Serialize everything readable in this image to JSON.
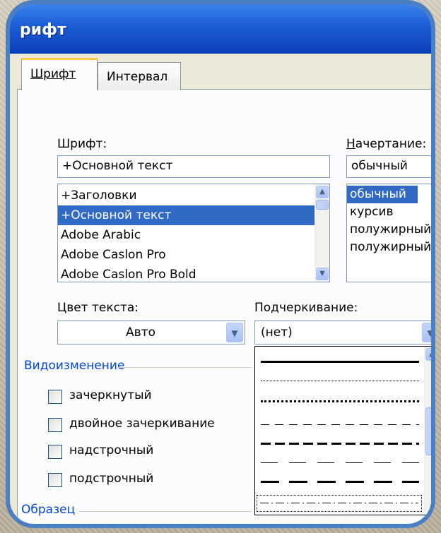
{
  "window": {
    "title": "рифт"
  },
  "tabs": [
    {
      "label": "Шрифт",
      "active": true
    },
    {
      "label": "Интервал",
      "active": false
    }
  ],
  "font": {
    "label": "Шрифт:",
    "value": "+Основной текст",
    "items": [
      "+Заголовки",
      "+Основной текст",
      "Adobe Arabic",
      "Adobe Caslon Pro",
      "Adobe Caslon Pro Bold"
    ],
    "selected_index": 1
  },
  "style": {
    "label": "Начертание:",
    "value": "обычный",
    "items": [
      "обычный",
      "курсив",
      "полужирный",
      "полужирный"
    ],
    "selected_index": 0
  },
  "color": {
    "label": "Цвет текста:",
    "value": "Авто"
  },
  "underline": {
    "label": "Подчеркивание:",
    "value": "(нет)",
    "options": [
      "solid",
      "dotted-fine",
      "dotted-heavy",
      "dashed",
      "dashed-heavy",
      "long-dash",
      "long-dash-heavy",
      "dash-dot"
    ],
    "selected_option": "dash-dot"
  },
  "effects": {
    "label": "Видоизменение",
    "items": [
      "зачеркнутый",
      "двойное зачеркивание",
      "надстрочный",
      "подстрочный"
    ]
  },
  "sample": {
    "label": "Образец"
  },
  "colors": {
    "accent": "#316ac5",
    "frame": "#4a7fc1",
    "title_dark": "#0a3fb8",
    "section": "#0046d5"
  },
  "icons": [
    "up-arrow-icon",
    "down-arrow-icon",
    "scroll-grip-icon"
  ]
}
